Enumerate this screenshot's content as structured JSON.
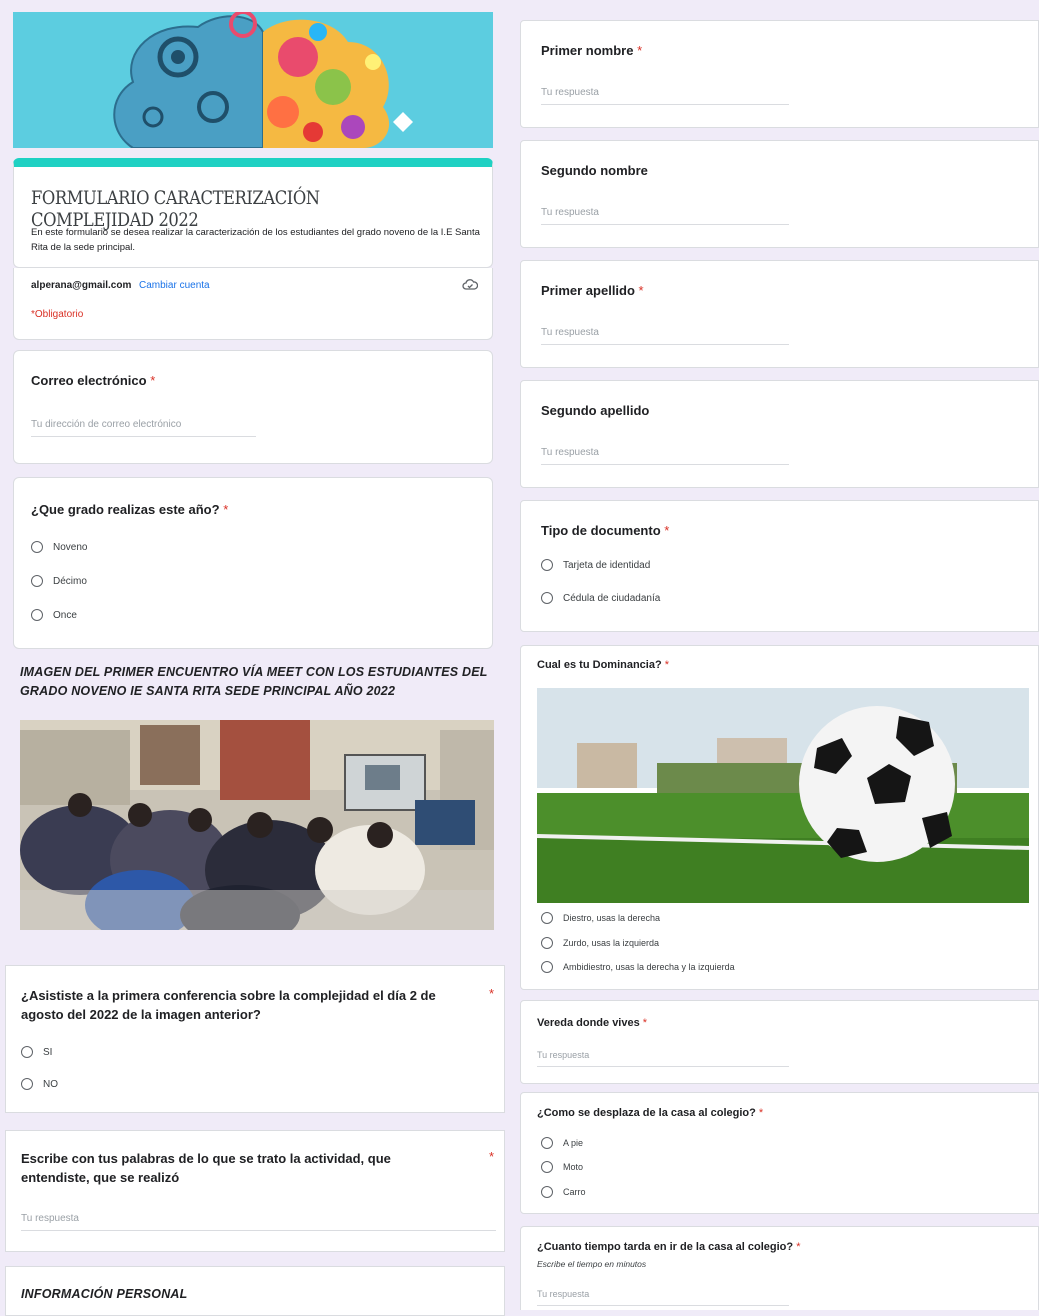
{
  "form": {
    "title": "FORMULARIO CARACTERIZACIÓN COMPLEJIDAD 2022",
    "description": "En este formulario se desea realizar la caracterización de los estudiantes del grado noveno de la I.E Santa Rita de la sede principal.",
    "account_email": "alperana@gmail.com",
    "change_account": "Cambiar cuenta",
    "required_note": "*Obligatorio"
  },
  "colors": {
    "accent": "#1fd1c3",
    "banner": "#5ccde0",
    "required": "#d93025",
    "link": "#1a73e8"
  },
  "left": {
    "email": {
      "label": "Correo electrónico",
      "req": "*",
      "placeholder": "Tu dirección de correo electrónico"
    },
    "grade": {
      "label": "¿Que grado realizas este año?",
      "req": "*",
      "options": [
        "Noveno",
        "Décimo",
        "Once"
      ]
    },
    "section1": "IMAGEN DEL PRIMER ENCUENTRO VÍA MEET CON LOS ESTUDIANTES DEL GRADO NOVENO IE SANTA RITA SEDE PRINCIPAL AÑO 2022",
    "attended": {
      "label": "¿Asististe a la primera conferencia sobre la complejidad el día 2 de agosto del 2022 de la imagen anterior?",
      "req": "*",
      "options": [
        "SI",
        "NO"
      ]
    },
    "describe": {
      "label": "Escribe con tus palabras de lo que se trato la actividad, que entendiste, que se realizó",
      "req": "*",
      "placeholder": "Tu respuesta"
    },
    "section2": "INFORMACIÓN PERSONAL"
  },
  "right": {
    "first_name": {
      "label": "Primer nombre",
      "req": "*",
      "placeholder": "Tu respuesta"
    },
    "second_name": {
      "label": "Segundo nombre",
      "placeholder": "Tu respuesta"
    },
    "first_surname": {
      "label": "Primer apellido",
      "req": "*",
      "placeholder": "Tu respuesta"
    },
    "second_surname": {
      "label": "Segundo apellido",
      "placeholder": "Tu respuesta"
    },
    "doc_type": {
      "label": "Tipo de documento",
      "req": "*",
      "options": [
        "Tarjeta de identidad",
        "Cédula de ciudadanía"
      ]
    },
    "dominance": {
      "label": "Cual es tu Dominancia?",
      "req": "*",
      "options": [
        "Diestro, usas la derecha",
        "Zurdo, usas la izquierda",
        "Ambidiestro, usas la derecha y la izquierda"
      ]
    },
    "vereda": {
      "label": "Vereda donde vives",
      "req": "*",
      "placeholder": "Tu respuesta"
    },
    "transport": {
      "label": "¿Como se desplaza de la casa al colegio?",
      "req": "*",
      "options": [
        "A pie",
        "Moto",
        "Carro"
      ]
    },
    "time": {
      "label": "¿Cuanto tiempo tarda en ir de la casa al colegio?",
      "req": "*",
      "hint": "Escribe el tiempo en minutos",
      "placeholder": "Tu respuesta"
    }
  }
}
